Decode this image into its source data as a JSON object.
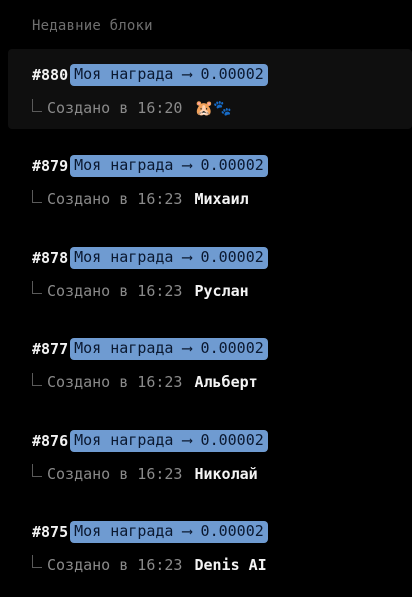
{
  "section_title": "Недавние блоки",
  "colors": {
    "background": "#000000",
    "reward_badge": "#6f9bd1",
    "muted_text": "#8a8a8a"
  },
  "blocks": [
    {
      "id": "#880",
      "reward": "Моя награда ⟶ 0.00002",
      "created": "Создано в 16:20",
      "author": "🐹🐾",
      "selected": true
    },
    {
      "id": "#879",
      "reward": "Моя награда ⟶ 0.00002",
      "created": "Создано в 16:23",
      "author": "Михаил",
      "selected": false
    },
    {
      "id": "#878",
      "reward": "Моя награда ⟶ 0.00002",
      "created": "Создано в 16:23",
      "author": "Руслан",
      "selected": false
    },
    {
      "id": "#877",
      "reward": "Моя награда ⟶ 0.00002",
      "created": "Создано в 16:23",
      "author": "Альберт",
      "selected": false
    },
    {
      "id": "#876",
      "reward": "Моя награда ⟶ 0.00002",
      "created": "Создано в 16:23",
      "author": "Николай",
      "selected": false
    },
    {
      "id": "#875",
      "reward": "Моя награда ⟶ 0.00002",
      "created": "Создано в 16:23",
      "author": "Denis AI",
      "selected": false
    }
  ]
}
